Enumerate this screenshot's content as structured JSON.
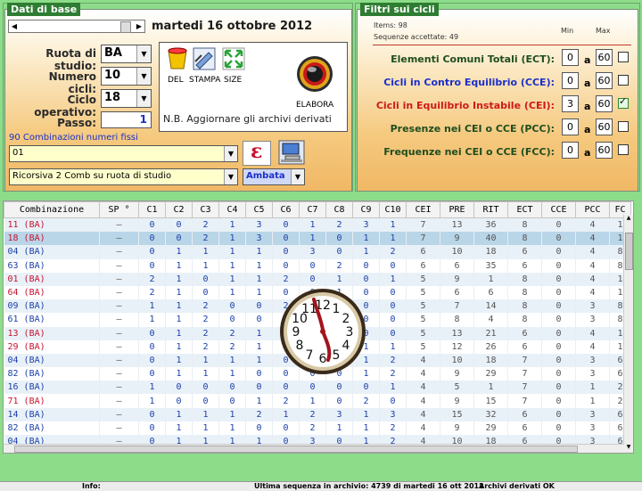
{
  "left_panel": {
    "title": "Dati di base",
    "date": "martedi 16 ottobre 2012",
    "ruota_label": "Ruota di studio:",
    "ruota_value": "BA",
    "cicli_label": "Numero cicli:",
    "cicli_value": "10",
    "ciclo_label": "Ciclo operativo:",
    "ciclo_value": "18",
    "passo_label": "Passo:",
    "passo_value": "1",
    "del_label": "DEL",
    "stampa_label": "STAMPA",
    "size_label": "SIZE",
    "elabora_label": "ELABORA",
    "note": "N.B. Aggiornare gli archivi derivati",
    "combinazioni_label": "90 Combinazioni numeri fissi",
    "combo_value": "01",
    "ricorsiva_value": "Ricorsiva 2 Comb su ruota di studio",
    "ambata_value": "Ambata",
    "epsilon_symbol": "ε"
  },
  "right_panel": {
    "title": "Filtri sui cicli",
    "items": "Items: 98",
    "sequenze": "Sequenze accettate: 49",
    "min_label": "Min",
    "max_label": "Max",
    "a_label": "a",
    "filters": [
      {
        "label": "Elementi Comuni Totali (ECT):",
        "min": "0",
        "max": "60",
        "checked": false,
        "color": "#1f4d1f"
      },
      {
        "label": "Cicli in Contro Equilibrio (CCE):",
        "min": "0",
        "max": "60",
        "checked": false,
        "color": "#1a2fcc"
      },
      {
        "label": "Cicli in Equilibrio Instabile (CEI):",
        "min": "3",
        "max": "60",
        "checked": true,
        "color": "#cc1a1a"
      },
      {
        "label": "Presenze nei CEI o CCE (PCC):",
        "min": "0",
        "max": "60",
        "checked": false,
        "color": "#1f4d1f"
      },
      {
        "label": "Frequenze nei CEI o CCE (FCC):",
        "min": "0",
        "max": "60",
        "checked": false,
        "color": "#1f4d1f"
      }
    ]
  },
  "grid": {
    "headers": [
      "Combinazione",
      "SP °",
      "C1",
      "C2",
      "C3",
      "C4",
      "C5",
      "C6",
      "C7",
      "C8",
      "C9",
      "C10",
      "CEI",
      "PRE",
      "RIT",
      "ECT",
      "CCE",
      "PCC",
      "FC"
    ],
    "rows": [
      {
        "c": "11  (BA)",
        "red": true,
        "v": [
          "–",
          "0",
          "0",
          "2",
          "1",
          "3",
          "0",
          "1",
          "2",
          "3",
          "1",
          "7",
          "13",
          "36",
          "8",
          "0",
          "4",
          "1"
        ]
      },
      {
        "c": "18  (BA)",
        "red": true,
        "v": [
          "–",
          "0",
          "0",
          "2",
          "1",
          "3",
          "0",
          "1",
          "0",
          "1",
          "1",
          "7",
          "9",
          "40",
          "8",
          "0",
          "4",
          "1"
        ]
      },
      {
        "c": "04  (BA)",
        "red": false,
        "v": [
          "–",
          "0",
          "1",
          "1",
          "1",
          "1",
          "0",
          "3",
          "0",
          "1",
          "2",
          "6",
          "10",
          "18",
          "6",
          "0",
          "4",
          "8"
        ]
      },
      {
        "c": "63  (BA)",
        "red": false,
        "v": [
          "–",
          "0",
          "1",
          "1",
          "1",
          "1",
          "0",
          "0",
          "2",
          "0",
          "0",
          "6",
          "6",
          "35",
          "6",
          "0",
          "4",
          "8"
        ]
      },
      {
        "c": "01  (BA)",
        "red": true,
        "v": [
          "–",
          "2",
          "1",
          "0",
          "1",
          "1",
          "2",
          "0",
          "1",
          "0",
          "1",
          "5",
          "9",
          "1",
          "8",
          "0",
          "4",
          "1"
        ]
      },
      {
        "c": "64  (BA)",
        "red": true,
        "v": [
          "–",
          "2",
          "1",
          "0",
          "1",
          "1",
          "0",
          "0",
          "1",
          "0",
          "0",
          "5",
          "6",
          "6",
          "8",
          "0",
          "4",
          "1"
        ]
      },
      {
        "c": "09  (BA)",
        "red": false,
        "v": [
          "–",
          "1",
          "1",
          "2",
          "0",
          "0",
          "2",
          "0",
          "0",
          "0",
          "0",
          "5",
          "7",
          "14",
          "8",
          "0",
          "3",
          "8"
        ]
      },
      {
        "c": "61  (BA)",
        "red": false,
        "v": [
          "–",
          "1",
          "1",
          "2",
          "0",
          "0",
          "0",
          "0",
          "0",
          "0",
          "0",
          "5",
          "8",
          "4",
          "8",
          "0",
          "3",
          "8"
        ]
      },
      {
        "c": "13  (BA)",
        "red": true,
        "v": [
          "–",
          "0",
          "1",
          "2",
          "2",
          "1",
          "0",
          "0",
          "0",
          "0",
          "0",
          "5",
          "13",
          "21",
          "6",
          "0",
          "4",
          "1"
        ]
      },
      {
        "c": "29  (BA)",
        "red": true,
        "v": [
          "–",
          "0",
          "1",
          "2",
          "2",
          "1",
          "0",
          "0",
          "0",
          "1",
          "1",
          "5",
          "12",
          "26",
          "6",
          "0",
          "4",
          "1"
        ]
      },
      {
        "c": "04  (BA)",
        "red": false,
        "v": [
          "–",
          "0",
          "1",
          "1",
          "1",
          "1",
          "0",
          "0",
          "0",
          "1",
          "2",
          "4",
          "10",
          "18",
          "7",
          "0",
          "3",
          "6"
        ]
      },
      {
        "c": "82  (BA)",
        "red": false,
        "v": [
          "–",
          "0",
          "1",
          "1",
          "1",
          "0",
          "0",
          "0",
          "0",
          "1",
          "2",
          "4",
          "9",
          "29",
          "7",
          "0",
          "3",
          "6"
        ]
      },
      {
        "c": "16  (BA)",
        "red": false,
        "v": [
          "–",
          "1",
          "0",
          "0",
          "0",
          "0",
          "0",
          "0",
          "0",
          "0",
          "1",
          "4",
          "5",
          "1",
          "7",
          "0",
          "1",
          "2"
        ]
      },
      {
        "c": "71  (BA)",
        "red": true,
        "v": [
          "–",
          "1",
          "0",
          "0",
          "0",
          "1",
          "2",
          "1",
          "0",
          "2",
          "0",
          "4",
          "9",
          "15",
          "7",
          "0",
          "1",
          "2"
        ]
      },
      {
        "c": "14  (BA)",
        "red": false,
        "v": [
          "–",
          "0",
          "1",
          "1",
          "1",
          "2",
          "1",
          "2",
          "3",
          "1",
          "3",
          "4",
          "15",
          "32",
          "6",
          "0",
          "3",
          "6"
        ]
      },
      {
        "c": "82  (BA)",
        "red": false,
        "v": [
          "–",
          "0",
          "1",
          "1",
          "1",
          "0",
          "0",
          "2",
          "1",
          "1",
          "2",
          "4",
          "9",
          "29",
          "6",
          "0",
          "3",
          "6"
        ]
      },
      {
        "c": "04  (BA)",
        "red": false,
        "v": [
          "–",
          "0",
          "1",
          "1",
          "1",
          "1",
          "0",
          "3",
          "0",
          "1",
          "2",
          "4",
          "10",
          "18",
          "6",
          "0",
          "3",
          "6"
        ]
      },
      {
        "c": "55  (BA)",
        "red": true,
        "v": [
          "–",
          "0",
          "1",
          "1",
          "1",
          "4",
          "2",
          "0",
          "0",
          "1",
          "0",
          "4",
          "10",
          "30",
          "6",
          "0",
          "3",
          "6"
        ]
      },
      {
        "c": "04  (BA)",
        "red": false,
        "v": [
          "–",
          "0",
          "1",
          "1",
          "1",
          "1",
          "0",
          "3",
          "0",
          "1",
          "2",
          "4",
          "10",
          "18",
          "6",
          "0",
          "3",
          "6"
        ]
      }
    ]
  },
  "status": {
    "info": "Info:",
    "ultima": "Ultima sequenza in archivio: 4739 di martedi 16 ott 2012",
    "archivi": "Archivi derivati OK"
  },
  "clock": {
    "numbers": [
      "12",
      "1",
      "2",
      "3",
      "4",
      "5",
      "6",
      "7",
      "8",
      "9",
      "10",
      "11"
    ]
  }
}
